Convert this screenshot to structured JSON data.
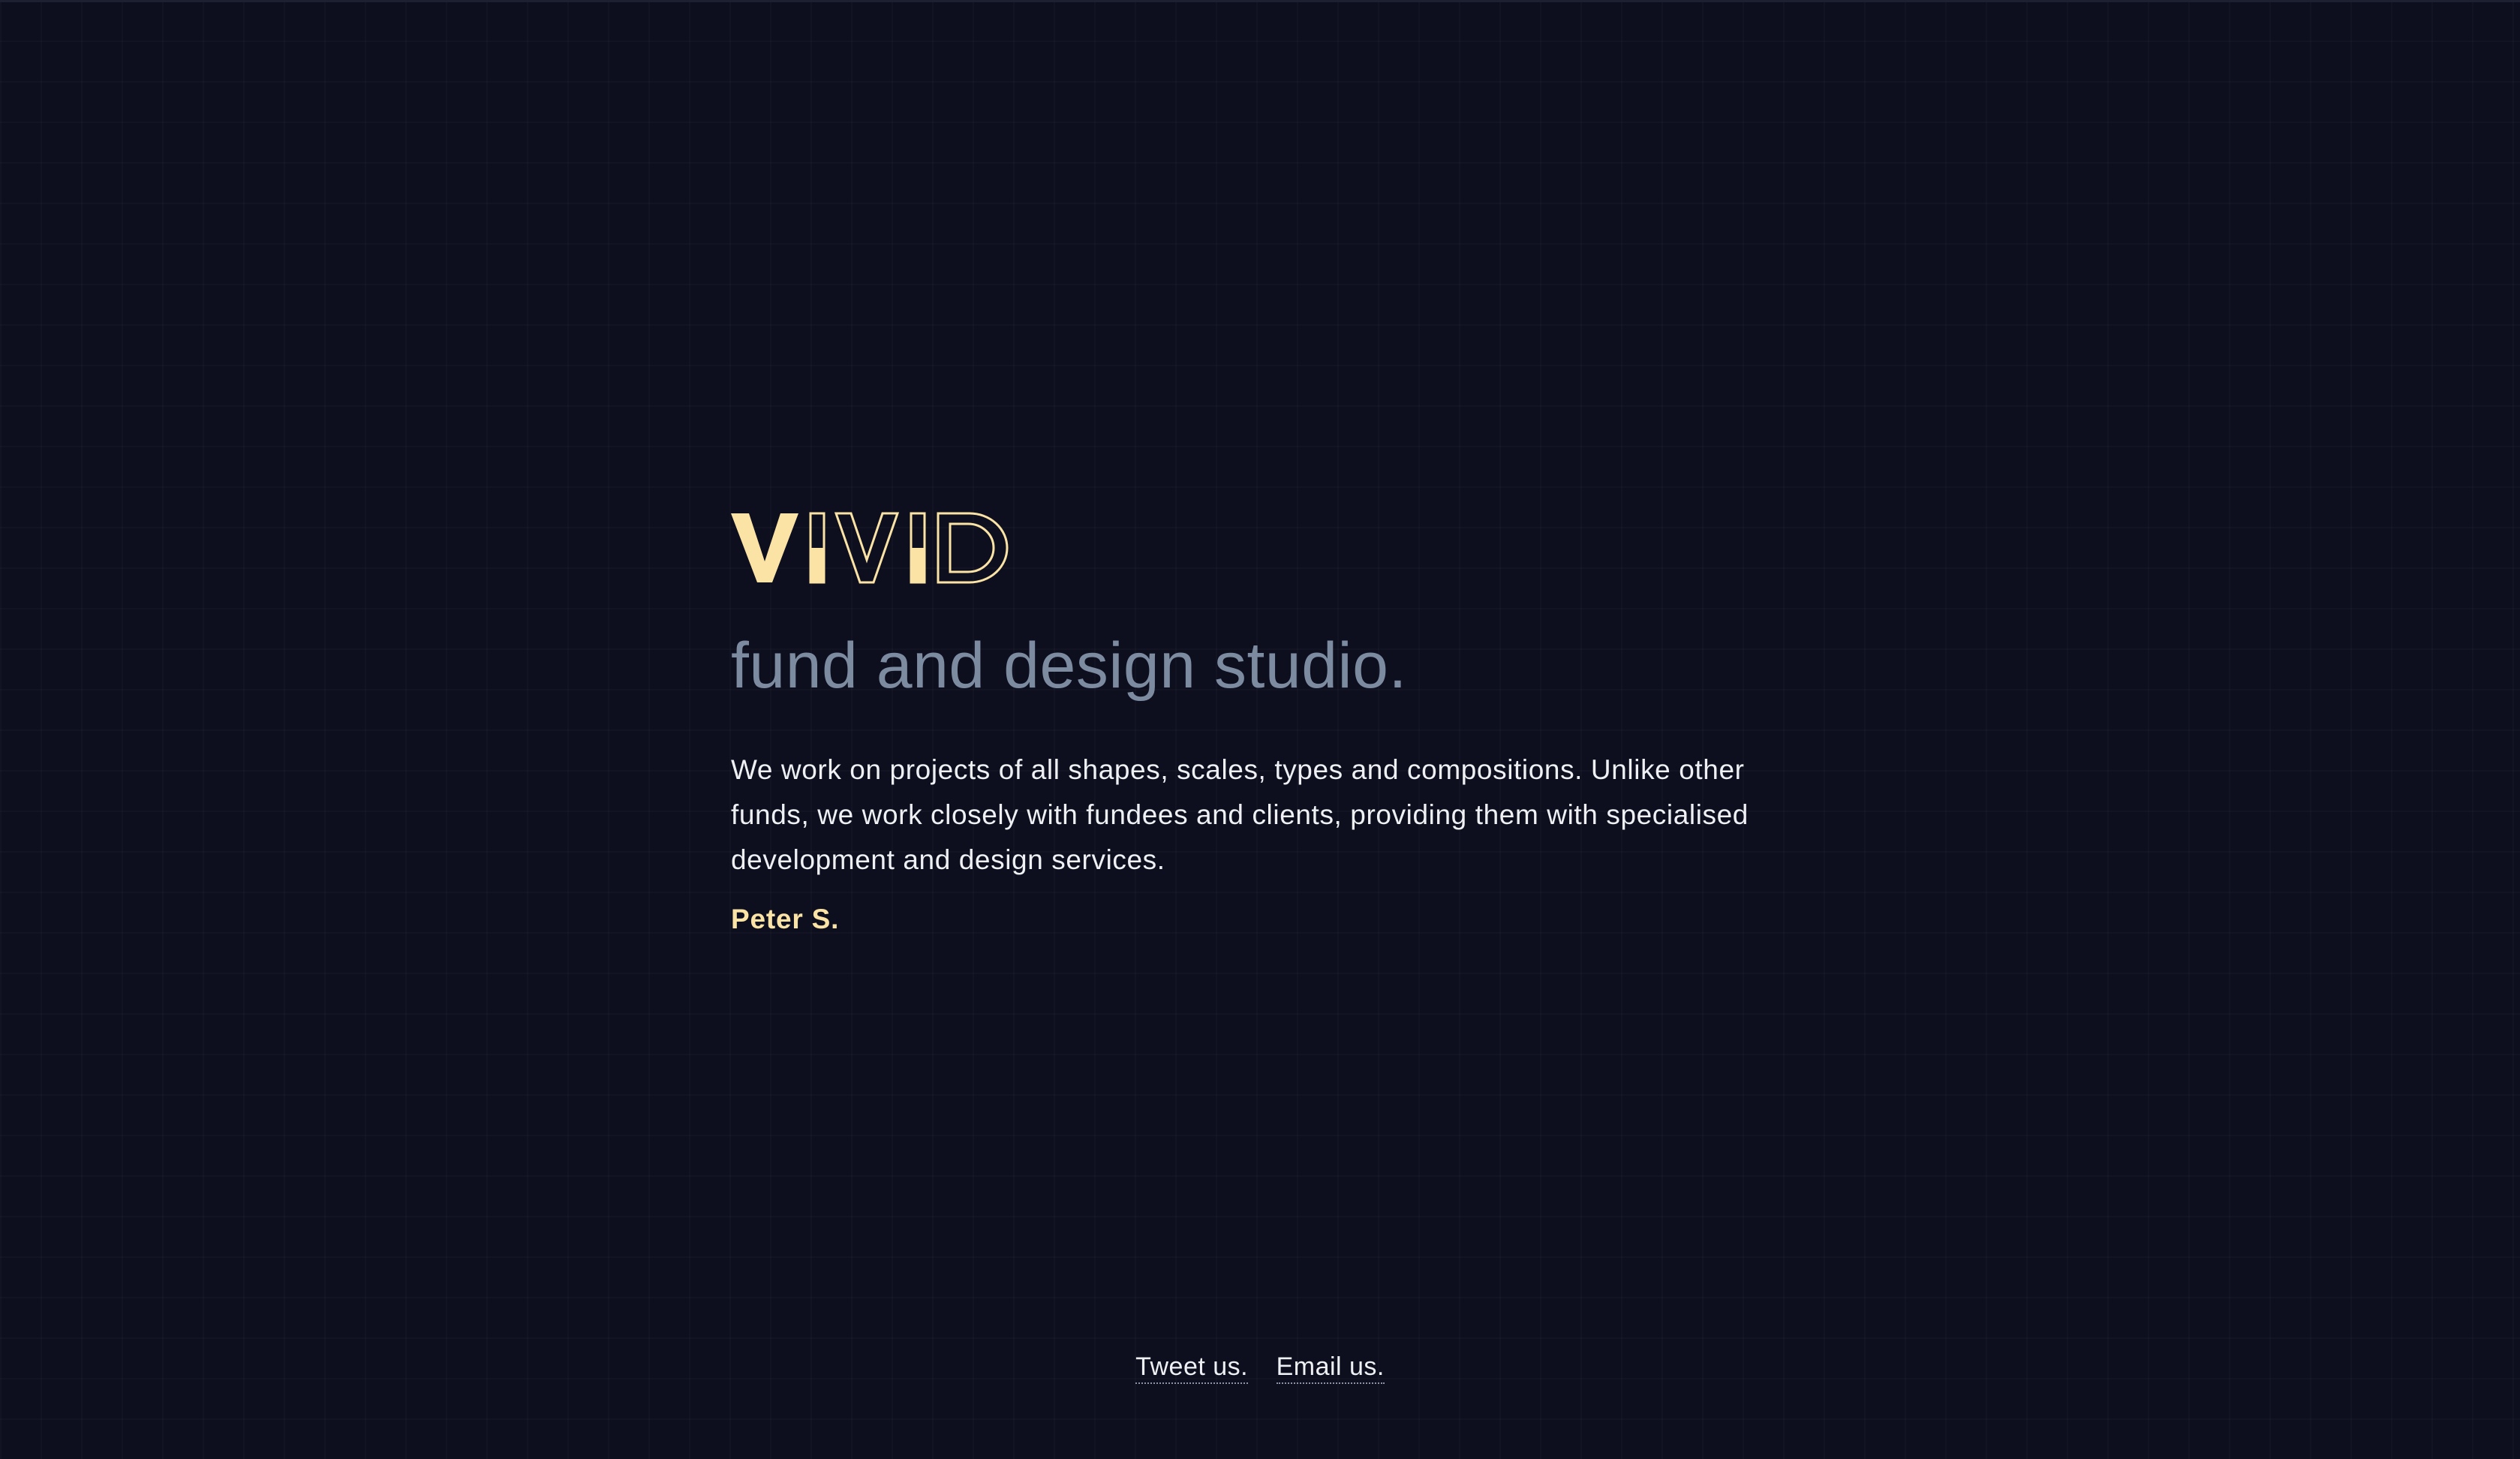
{
  "brand": {
    "logo_text": "VIVID",
    "tagline": "fund and design studio."
  },
  "main": {
    "description": "We work on projects of all shapes, scales, types and compositions. Unlike other funds, we work closely with fundees and clients, providing them with specialised development and design services.",
    "signature": "Peter S."
  },
  "footer": {
    "links": [
      {
        "label": "Tweet us."
      },
      {
        "label": "Email us."
      }
    ]
  },
  "colors": {
    "background": "#0d0f1f",
    "accent": "#fbe3a6",
    "tagline": "#7d8ba0",
    "text": "#eef0f4"
  }
}
